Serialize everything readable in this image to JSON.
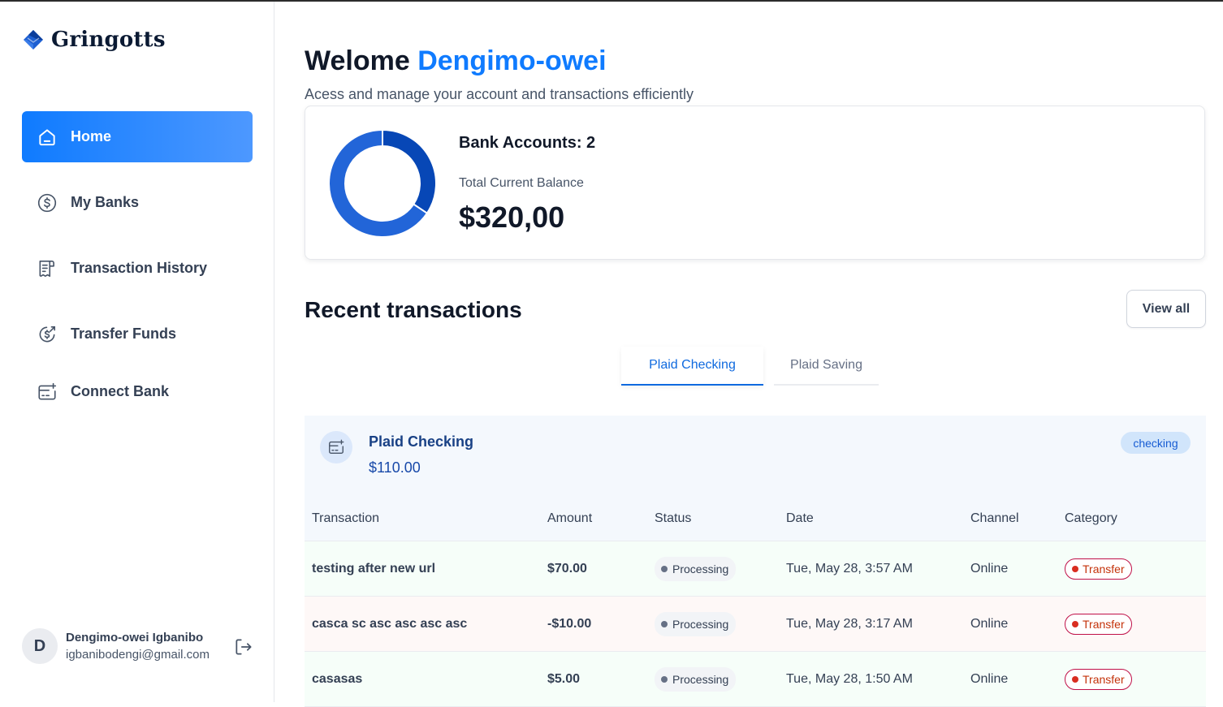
{
  "brand": {
    "name": "Gringotts",
    "logo_icon": "gringotts-logo-icon",
    "accent": "#0f7bff"
  },
  "sidebar": {
    "items": [
      {
        "label": "Home",
        "icon": "home-icon",
        "active": true
      },
      {
        "label": "My Banks",
        "icon": "dollar-circle-icon",
        "active": false
      },
      {
        "label": "Transaction History",
        "icon": "receipt-icon",
        "active": false
      },
      {
        "label": "Transfer Funds",
        "icon": "money-send-icon",
        "active": false
      },
      {
        "label": "Connect Bank",
        "icon": "card-add-icon",
        "active": false
      }
    ],
    "user": {
      "initial": "D",
      "name": "Dengimo-owei Igbanibo",
      "email": "igbanibodengi@gmail.com",
      "logout_icon": "logout-icon"
    }
  },
  "header": {
    "greeting": "Welome",
    "user_name": "Dengimo-owei",
    "subtitle": "Acess and manage your account and transactions efficiently"
  },
  "balance": {
    "bank_accounts_label": "Bank Accounts: 2",
    "total_label": "Total Current Balance",
    "total_value": "$320,00",
    "chart_data": {
      "type": "pie",
      "values": [
        110,
        210
      ],
      "colors": [
        "#0747b6",
        "#2265d8"
      ]
    }
  },
  "recent": {
    "title": "Recent transactions",
    "view_all_label": "View all",
    "tabs": [
      {
        "label": "Plaid Checking",
        "active": true
      },
      {
        "label": "Plaid Saving",
        "active": false
      }
    ],
    "account": {
      "name": "Plaid Checking",
      "balance": "$110.00",
      "type_badge": "checking",
      "icon": "card-add-icon"
    },
    "table": {
      "columns": [
        "Transaction",
        "Amount",
        "Status",
        "Date",
        "Channel",
        "Category"
      ],
      "rows": [
        {
          "name": "testing after new url",
          "amount": "$70.00",
          "kind": "credit",
          "status": "Processing",
          "date": "Tue, May 28, 3:57 AM",
          "channel": "Online",
          "category": "Transfer"
        },
        {
          "name": "casca sc asc asc asc asc",
          "amount": "-$10.00",
          "kind": "debit",
          "status": "Processing",
          "date": "Tue, May 28, 3:17 AM",
          "channel": "Online",
          "category": "Transfer"
        },
        {
          "name": "casasas",
          "amount": "$5.00",
          "kind": "credit",
          "status": "Processing",
          "date": "Tue, May 28, 1:50 AM",
          "channel": "Online",
          "category": "Transfer"
        }
      ]
    }
  }
}
